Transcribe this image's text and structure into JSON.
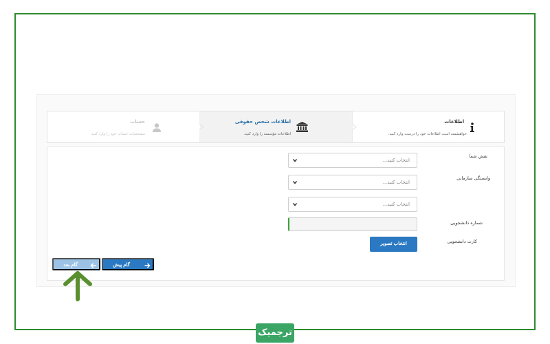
{
  "steps": [
    {
      "title": "اطلاعات",
      "description": "خواهشمند است اطلاعات خود را درست وارد کنید.",
      "icon": "info-icon",
      "state": "completed"
    },
    {
      "title": "اطلاعات شخص حقوقی",
      "description": "اطلاعات مؤسسه را وارد کنید.",
      "icon": "institution-icon",
      "state": "active"
    },
    {
      "title": "حساب",
      "description": "مشخصات حساب خود را وارد کنید.",
      "icon": "user-icon",
      "state": "disabled"
    }
  ],
  "form": {
    "role": {
      "label": "نقش شما",
      "value": "انتخاب کنید..."
    },
    "affiliation": {
      "label": "وابستگی سازمانی",
      "value": "انتخاب کنید..."
    },
    "third_select": {
      "label": "",
      "value": "انتخاب کنید..."
    },
    "student_number": {
      "label": "شماره دانشجویی",
      "value": ""
    },
    "student_card": {
      "label": "کارت دانشجویی",
      "button_label": "انتخاب تصویر"
    }
  },
  "navigation": {
    "prev_label": "گام پیش",
    "next_label": "گام بعد"
  },
  "brand": {
    "text": "ترجمیک"
  },
  "colors": {
    "frame_border": "#2e8b2e",
    "primary_button": "#2b79c2",
    "disabled_button": "#9cc3e6",
    "annotation_arrow": "#5a8f2f",
    "brand_bg": "#3aa564"
  }
}
